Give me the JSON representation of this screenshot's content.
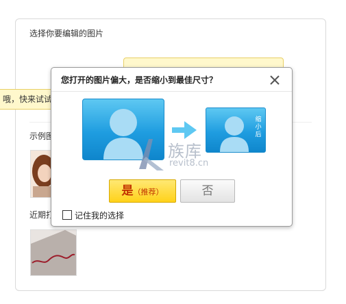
{
  "panel": {
    "title": "选择你要编辑的图片",
    "hint_text": "哦，快来试试",
    "example_label": "示例图",
    "recent_label": "近期打"
  },
  "dialog": {
    "title": "您打开的图片偏大，是否缩小到最佳尺寸？",
    "small_caption": "缩小后",
    "yes_label": "是",
    "yes_sub_label": "（推荐）",
    "no_label": "否",
    "remember_label": "记住我的选择",
    "remember_checked": false
  },
  "watermark": {
    "main": "族库",
    "sub": "revit8.cn"
  },
  "colors": {
    "card_blue": "#1f9de0",
    "yes_yellow": "#ffd21a",
    "yes_text": "#c23400",
    "tip_bg": "#fff8cc"
  },
  "icons": {
    "close": "close-icon",
    "arrow": "arrow-right-icon",
    "person": "person-silhouette-icon"
  }
}
